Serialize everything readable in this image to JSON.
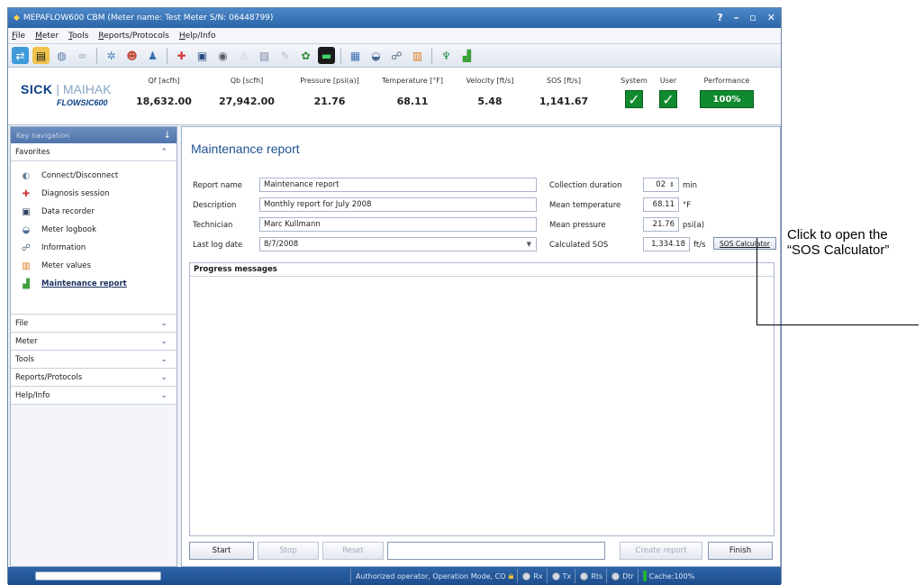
{
  "titlebar": {
    "title": "MEPAFLOW600 CBM (Meter name: Test Meter S/N: 06448799)",
    "controls": [
      "?",
      "–",
      "▫",
      "✕"
    ]
  },
  "menu": [
    "File",
    "Meter",
    "Tools",
    "Reports/Protocols",
    "Help/Info"
  ],
  "header": {
    "logo_sick": "SICK",
    "logo_maihak": "MAIHAK",
    "logo_product": "FLOWSIC600",
    "measurements": [
      {
        "label": "Qf [acfh]",
        "value": "18,632.00"
      },
      {
        "label": "Qb [scfh]",
        "value": "27,942.00"
      },
      {
        "label": "Pressure [psi(a)]",
        "value": "21.76"
      },
      {
        "label": "Temperature [°F]",
        "value": "68.11"
      },
      {
        "label": "Velocity [ft/s]",
        "value": "5.48"
      },
      {
        "label": "SOS [ft/s]",
        "value": "1,141.67"
      }
    ],
    "system_label": "System",
    "user_label": "User",
    "performance_label": "Performance",
    "performance_value": "100%",
    "check_glyph": "✓"
  },
  "sidebar": {
    "title": "Key navigation",
    "pin": "↓",
    "favorites_label": "Favorites",
    "favorites": [
      {
        "label": "Connect/Disconnect",
        "icon": "connect-icon"
      },
      {
        "label": "Diagnosis session",
        "icon": "diagnosis-icon"
      },
      {
        "label": "Data recorder",
        "icon": "recorder-icon"
      },
      {
        "label": "Meter logbook",
        "icon": "logbook-icon"
      },
      {
        "label": "Information",
        "icon": "information-icon"
      },
      {
        "label": "Meter values",
        "icon": "meter-values-icon"
      },
      {
        "label": "Maintenance report",
        "icon": "report-icon"
      }
    ],
    "groups": [
      "File",
      "Meter",
      "Tools",
      "Reports/Protocols",
      "Help/Info"
    ],
    "chev_up": "≈",
    "chev_down": "≚"
  },
  "main": {
    "title": "Maintenance report",
    "report_name_label": "Report name",
    "report_name_value": "Maintenance report",
    "description_label": "Description",
    "description_value": "Monthly report for July 2008",
    "technician_label": "Technician",
    "technician_value": "Marc Kullmann",
    "last_log_label": "Last log date",
    "last_log_value": "8/7/2008",
    "collection_label": "Collection duration",
    "collection_value": "02",
    "collection_unit": "min",
    "mean_temp_label": "Mean temperature",
    "mean_temp_value": "68.11",
    "mean_temp_unit": "°F",
    "mean_pressure_label": "Mean pressure",
    "mean_pressure_value": "21.76",
    "mean_pressure_unit": "psi(a)",
    "calc_sos_label": "Calculated SOS",
    "calc_sos_value": "1,334.18",
    "calc_sos_unit": "ft/s",
    "sos_calc_button": "SOS Calculator",
    "progress_title": "Progress messages",
    "buttons": {
      "start": "Start",
      "stop": "Stop",
      "reset": "Reset",
      "create": "Create report",
      "finish": "Finish"
    }
  },
  "statusbar": {
    "operator": "Authorized operator, Operation Mode, CO",
    "rx": "Rx",
    "tx": "Tx",
    "rts": "Rts",
    "dtr": "Dtr",
    "cache": "Cache:100%"
  },
  "annotation": {
    "line1": "Click to open the",
    "line2": "“SOS Calculator”"
  },
  "colors": {
    "accent": "#2a65a8",
    "status_green": "#0f8a2e",
    "title_blue": "#1f4f8f"
  }
}
